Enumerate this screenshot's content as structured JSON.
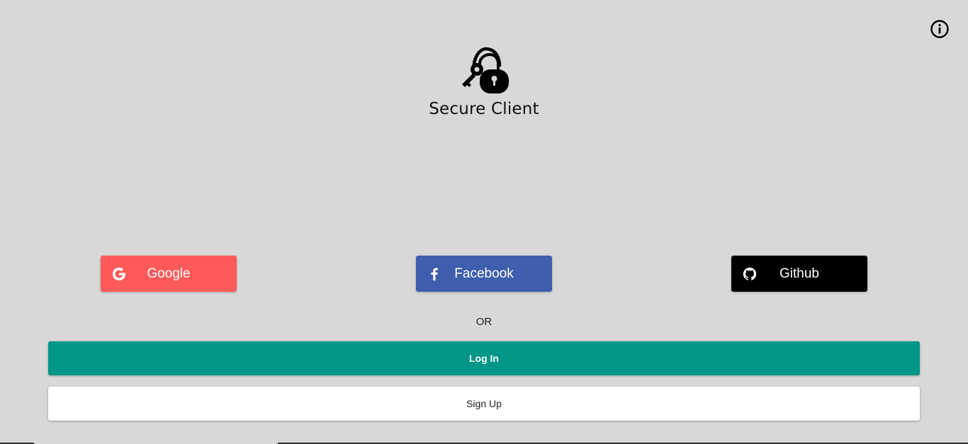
{
  "app": {
    "title": "Secure Client",
    "logo_icon": "key-lock-icon",
    "info_icon": "info-icon"
  },
  "social": {
    "google": {
      "label": "Google",
      "icon": "google-icon",
      "color": "#ff5a5a"
    },
    "facebook": {
      "label": "Facebook",
      "icon": "facebook-icon",
      "color": "#3f5ead"
    },
    "github": {
      "label": "Github",
      "icon": "github-icon",
      "color": "#000000"
    }
  },
  "divider": {
    "text": "OR"
  },
  "actions": {
    "login_label": "Log In",
    "login_color": "#009688",
    "signup_label": "Sign Up",
    "signup_color": "#ffffff"
  }
}
